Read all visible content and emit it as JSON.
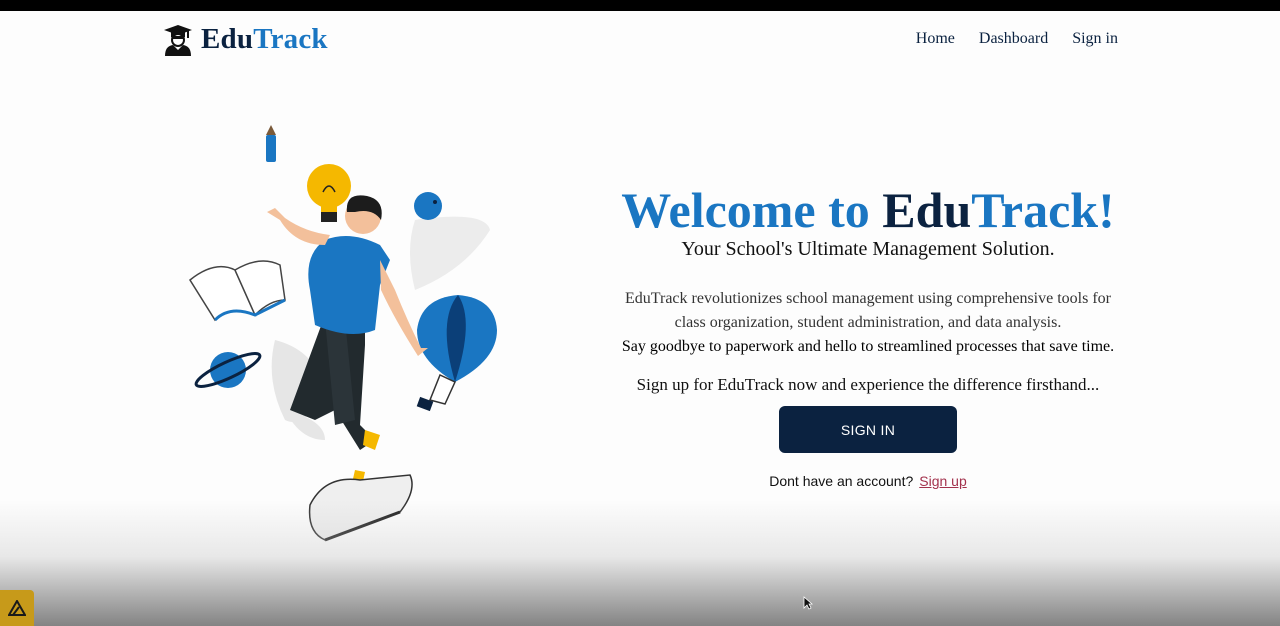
{
  "nav": {
    "logo_part1": "Edu",
    "logo_part2": "Track",
    "links": [
      "Home",
      "Dashboard",
      "Sign in"
    ]
  },
  "hero": {
    "title_part1": "Welcome to ",
    "title_part2": "Edu",
    "title_part3": "Track!",
    "subtitle": "Your School's Ultimate Management Solution.",
    "desc_line1": "EduTrack revolutionizes school management using comprehensive tools for",
    "desc_line2": "class organization, student administration, and data analysis.",
    "desc_line3": "Say goodbye to paperwork and hello to streamlined processes that save time.",
    "cta_text": "Sign up for EduTrack now and experience the difference firsthand...",
    "signin_button": "SIGN IN",
    "no_account_text": "Dont have an account?",
    "signup_link": "Sign up"
  },
  "colors": {
    "brand_dark": "#0b2240",
    "brand_blue": "#1a76c2",
    "link_red": "#a3324d",
    "accent_yellow": "#f5b800"
  },
  "icons": {
    "logo": "graduate-student-icon",
    "corner": "app-badge-icon"
  }
}
